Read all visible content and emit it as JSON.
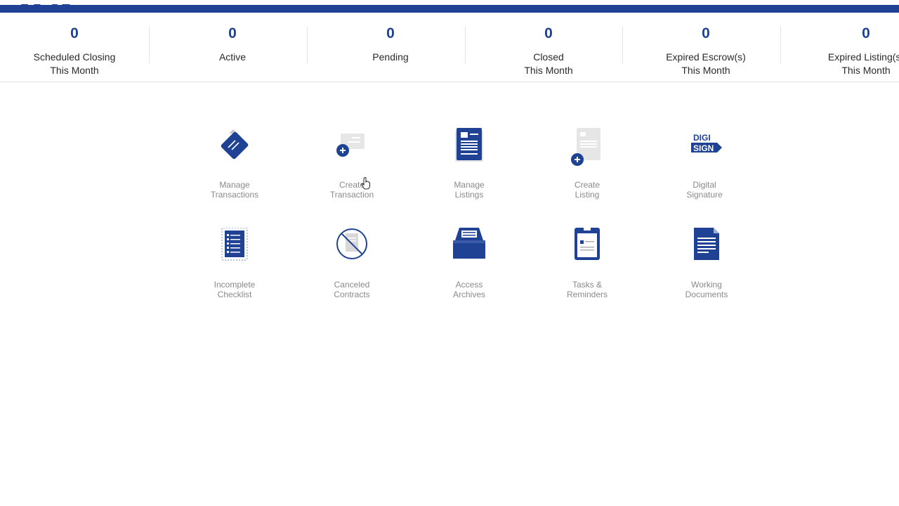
{
  "colors": {
    "accent": "#1f4294",
    "label": "#8a8a8a",
    "stat_label": "#2a2a2a"
  },
  "stats": [
    {
      "count": "0",
      "label": "Scheduled Closing\nThis Month"
    },
    {
      "count": "0",
      "label": "Active"
    },
    {
      "count": "0",
      "label": "Pending"
    },
    {
      "count": "0",
      "label": "Closed\nThis Month"
    },
    {
      "count": "0",
      "label": "Expired Escrow(s)\nThis Month"
    },
    {
      "count": "0",
      "label": "Expired Listing(s)\nThis Month"
    }
  ],
  "tiles": [
    {
      "label": "Manage\nTransactions",
      "icon": "ticket-icon"
    },
    {
      "label": "Create\nTransaction",
      "icon": "add-transaction-icon"
    },
    {
      "label": "Manage\nListings",
      "icon": "listing-document-icon"
    },
    {
      "label": "Create\nListing",
      "icon": "add-listing-icon"
    },
    {
      "label": "Digital\nSignature",
      "icon": "digi-sign-icon",
      "icon_text_top": "DIGI",
      "icon_text_bottom": "SIGN"
    },
    {
      "label": "Incomplete\nChecklist",
      "icon": "checklist-icon"
    },
    {
      "label": "Canceled\nContracts",
      "icon": "canceled-icon"
    },
    {
      "label": "Access\nArchives",
      "icon": "archive-box-icon"
    },
    {
      "label": "Tasks &\nReminders",
      "icon": "clipboard-icon"
    },
    {
      "label": "Working\nDocuments",
      "icon": "working-document-icon"
    }
  ]
}
